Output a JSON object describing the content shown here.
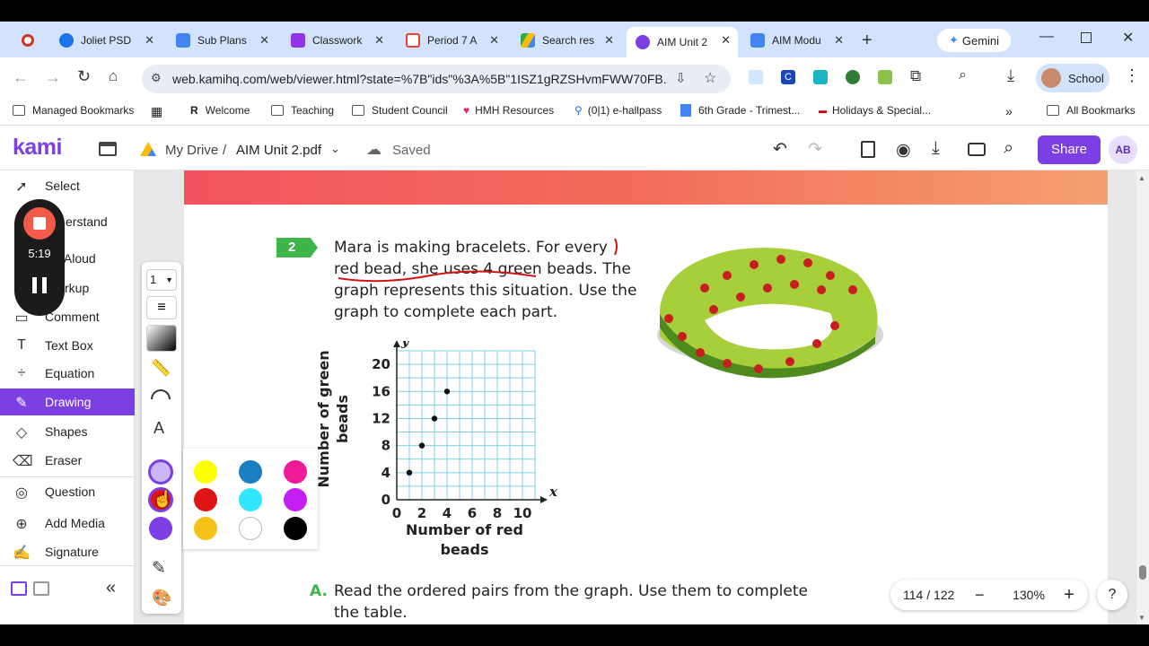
{
  "tabs": [
    {
      "label": "",
      "color": "#d93025"
    },
    {
      "label": "Joliet PSD",
      "color": "#1a73e8"
    },
    {
      "label": "Sub Plans",
      "color": "#4285f4"
    },
    {
      "label": "Classwork",
      "color": "#9334e6"
    },
    {
      "label": "Period 7 A",
      "color": "#ea4335"
    },
    {
      "label": "Search res",
      "color": "#34a853"
    },
    {
      "label": "AIM Unit 2",
      "color": "#7b3fe4"
    },
    {
      "label": "AIM Modu",
      "color": "#4285f4"
    }
  ],
  "browser": {
    "url": "web.kamihq.com/web/viewer.html?state=%7B\"ids\"%3A%5B\"1ISZ1gRZSHvmFWW70FB...",
    "gemini": "Gemini",
    "profile": "School"
  },
  "bookmarks": [
    "Managed Bookmarks",
    "Welcome",
    "Teaching",
    "Student Council",
    "HMH Resources",
    "(0|1) e-hallpass",
    "6th Grade - Trimest...",
    "Holidays & Special...",
    "All Bookmarks"
  ],
  "kami": {
    "logo": "kami",
    "drive": "My Drive",
    "sep": "/",
    "filename": "AIM Unit 2.pdf",
    "saved": "Saved",
    "share": "Share",
    "avatar": "AB"
  },
  "tools": [
    "Select",
    "Understand",
    "Read Aloud",
    "Markup",
    "Comment",
    "Text Box",
    "Equation",
    "Drawing",
    "Shapes",
    "Eraser",
    "Question",
    "Add Media",
    "Signature"
  ],
  "tools_visible": [
    "Select",
    "erstand",
    "d Aloud",
    "rkup",
    "Comment",
    "Text Box",
    "Equation",
    "Drawing",
    "Shapes",
    "Eraser",
    "Question",
    "Add Media",
    "Signature"
  ],
  "recording": {
    "time": "5:19"
  },
  "draw_panel": {
    "stroke_size": "1"
  },
  "palette": [
    "#c9b8f5",
    "#ffff00",
    "#1a7fc0",
    "#ee1a9a",
    "#e01616",
    "#33e6ff",
    "#c51ef2",
    "#7b3fe4",
    "#f5c21a",
    "#ffffff",
    "#000000"
  ],
  "problem": {
    "number": "2",
    "lines": [
      "Mara is making bracelets. For every",
      "red bead, she uses 4 green beads. The",
      "graph represents this situation. Use the",
      "graph to complete each part."
    ],
    "part_a_label": "A.",
    "part_a_lines": [
      "Read the ordered pairs from the graph. Use them to complete",
      "the table."
    ]
  },
  "chart_data": {
    "type": "scatter",
    "x": [
      1,
      2,
      3,
      4
    ],
    "y": [
      4,
      8,
      12,
      16
    ],
    "xlim": [
      0,
      11
    ],
    "ylim": [
      0,
      22
    ],
    "xticks": [
      "0",
      "2",
      "4",
      "6",
      "8",
      "10"
    ],
    "yticks": [
      "0",
      "4",
      "8",
      "12",
      "16",
      "20"
    ],
    "xlabel": "Number of red beads",
    "ylabel": "Number of green beads",
    "x_axis_letter": "x",
    "y_axis_letter": "y",
    "grid": true
  },
  "chart_text": {
    "xlabel_l1": "Number of red",
    "xlabel_l2": "beads",
    "ylabel_l1": "Number of green",
    "ylabel_l2": "beads"
  },
  "zoom": {
    "page": "114 / 122",
    "minus": "−",
    "level": "130%",
    "plus": "+"
  },
  "help": "?"
}
